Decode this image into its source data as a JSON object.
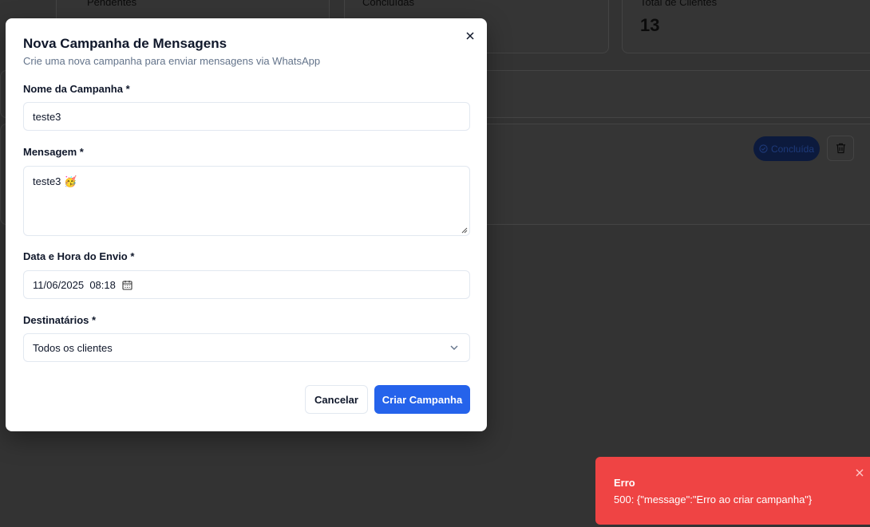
{
  "background": {
    "cards": [
      {
        "label": "Pendentes"
      },
      {
        "label": "Concluídas"
      },
      {
        "label": "Total de Clientes",
        "value": "13"
      }
    ],
    "campaign_status": "Concluída"
  },
  "modal": {
    "title": "Nova Campanha de Mensagens",
    "description": "Crie uma nova campanha para enviar mensagens via WhatsApp",
    "close_icon": "close-icon",
    "fields": {
      "name": {
        "label": "Nome da Campanha *",
        "value": "teste3"
      },
      "message": {
        "label": "Mensagem *",
        "value": "teste3 🥳"
      },
      "datetime": {
        "label": "Data e Hora do Envio *",
        "value": "11/06/2025  08:18",
        "icon": "calendar-icon"
      },
      "recipients": {
        "label": "Destinatários *",
        "value": "Todos os clientes",
        "icon": "chevron-down-icon"
      }
    },
    "buttons": {
      "cancel": "Cancelar",
      "create": "Criar Campanha"
    }
  },
  "toast": {
    "title": "Erro",
    "message": "500: {\"message\":\"Erro ao criar campanha\"}",
    "close_icon": "close-icon"
  },
  "colors": {
    "primary": "#2563eb",
    "error": "#ef4444",
    "overlay": "#333333",
    "muted_text": "#64748b"
  }
}
